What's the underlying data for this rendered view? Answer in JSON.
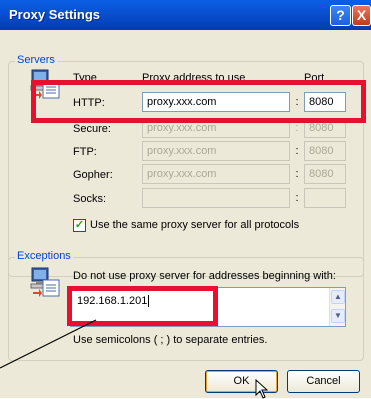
{
  "window": {
    "title": "Proxy Settings",
    "help_label": "?",
    "close_label": "X"
  },
  "servers": {
    "group_title": "Servers",
    "col_type": "Type",
    "col_address": "Proxy address to use",
    "col_port": "Port",
    "rows": [
      {
        "type": "HTTP:",
        "address": "proxy.xxx.com",
        "port": "8080",
        "enabled": true
      },
      {
        "type": "Secure:",
        "address": "proxy.xxx.com",
        "port": "8080",
        "enabled": false
      },
      {
        "type": "FTP:",
        "address": "proxy.xxx.com",
        "port": "8080",
        "enabled": false
      },
      {
        "type": "Gopher:",
        "address": "proxy.xxx.com",
        "port": "8080",
        "enabled": false
      },
      {
        "type": "Socks:",
        "address": "",
        "port": "",
        "enabled": false
      }
    ],
    "colon": ":",
    "same_proxy_label": "Use the same proxy server for all protocols",
    "same_proxy_checked": true
  },
  "exceptions": {
    "group_title": "Exceptions",
    "description": "Do not use proxy server for addresses beginning with:",
    "value": "192.168.1.201",
    "hint": "Use semicolons ( ; ) to separate entries."
  },
  "buttons": {
    "ok": "OK",
    "cancel": "Cancel"
  },
  "colors": {
    "highlight": "#e8102e",
    "titlebar": "#0a4fcf"
  }
}
